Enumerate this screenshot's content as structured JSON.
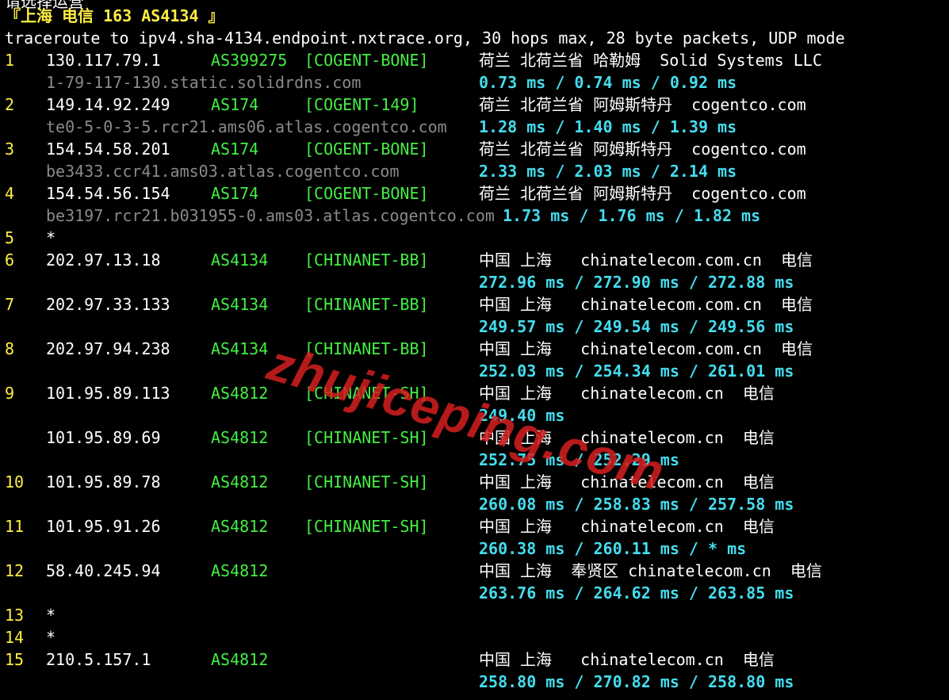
{
  "header": {
    "cut_off_line": "请选择运营",
    "title": "『上海 电信 163 AS4134 』",
    "command": "traceroute to ipv4.sha-4134.endpoint.nxtrace.org, 30 hops max, 28 byte packets, UDP mode"
  },
  "hops": [
    {
      "num": "1",
      "ip": "130.117.79.1",
      "asn": "AS399275",
      "tag": "[COGENT-BONE]",
      "geo": "荷兰 北荷兰省 哈勒姆  Solid Systems LLC",
      "host": "1-79-117-130.static.solidrdns.com",
      "rtt": "0.73 ms / 0.74 ms / 0.92 ms"
    },
    {
      "num": "2",
      "ip": "149.14.92.249",
      "asn": "AS174",
      "tag": "[COGENT-149]",
      "geo": "荷兰 北荷兰省 阿姆斯特丹  cogentco.com",
      "host": "te0-5-0-3-5.rcr21.ams06.atlas.cogentco.com",
      "rtt": "1.28 ms / 1.40 ms / 1.39 ms"
    },
    {
      "num": "3",
      "ip": "154.54.58.201",
      "asn": "AS174",
      "tag": "[COGENT-BONE]",
      "geo": "荷兰 北荷兰省 阿姆斯特丹  cogentco.com",
      "host": "be3433.ccr41.ams03.atlas.cogentco.com",
      "rtt": "2.33 ms / 2.03 ms / 2.14 ms"
    },
    {
      "num": "4",
      "ip": "154.54.56.154",
      "asn": "AS174",
      "tag": "[COGENT-BONE]",
      "geo": "荷兰 北荷兰省 阿姆斯特丹  cogentco.com",
      "host": "be3197.rcr21.b031955-0.ams03.atlas.cogentco.com",
      "rtt": "1.73 ms / 1.76 ms / 1.82 ms"
    },
    {
      "num": "5",
      "star": "*"
    },
    {
      "num": "6",
      "ip": "202.97.13.18",
      "asn": "AS4134",
      "tag": "[CHINANET-BB]",
      "geo": "中国 上海   chinatelecom.com.cn  电信",
      "rtt": "272.96 ms / 272.90 ms / 272.88 ms"
    },
    {
      "num": "7",
      "ip": "202.97.33.133",
      "asn": "AS4134",
      "tag": "[CHINANET-BB]",
      "geo": "中国 上海   chinatelecom.com.cn  电信",
      "rtt": "249.57 ms / 249.54 ms / 249.56 ms"
    },
    {
      "num": "8",
      "ip": "202.97.94.238",
      "asn": "AS4134",
      "tag": "[CHINANET-BB]",
      "geo": "中国 上海   chinatelecom.com.cn  电信",
      "rtt": "252.03 ms / 254.34 ms / 261.01 ms"
    },
    {
      "num": "9",
      "ip": "101.95.89.113",
      "asn": "AS4812",
      "tag": "[CHINANET-SH]",
      "geo": "中国 上海   chinatelecom.cn  电信",
      "rtt": "249.40 ms"
    },
    {
      "num": "",
      "ip": "101.95.89.69",
      "asn": "AS4812",
      "tag": "[CHINANET-SH]",
      "geo": "中国 上海   chinatelecom.cn  电信",
      "rtt": "252.75 ms / 252.29 ms"
    },
    {
      "num": "10",
      "ip": "101.95.89.78",
      "asn": "AS4812",
      "tag": "[CHINANET-SH]",
      "geo": "中国 上海   chinatelecom.cn  电信",
      "rtt": "260.08 ms / 258.83 ms / 257.58 ms"
    },
    {
      "num": "11",
      "ip": "101.95.91.26",
      "asn": "AS4812",
      "tag": "[CHINANET-SH]",
      "geo": "中国 上海   chinatelecom.cn  电信",
      "rtt": "260.38 ms / 260.11 ms / * ms"
    },
    {
      "num": "12",
      "ip": "58.40.245.94",
      "asn": "AS4812",
      "tag": "",
      "geo": "中国 上海  奉贤区 chinatelecom.cn  电信",
      "rtt": "263.76 ms / 264.62 ms / 263.85 ms"
    },
    {
      "num": "13",
      "star": "*"
    },
    {
      "num": "14",
      "star": "*"
    },
    {
      "num": "15",
      "ip": "210.5.157.1",
      "asn": "AS4812",
      "tag": "",
      "geo": "中国 上海   chinatelecom.cn  电信",
      "rtt": "258.80 ms / 270.82 ms / 258.80 ms"
    }
  ],
  "watermark": "zhujiceping.com",
  "colors": {
    "background": "#000000",
    "hop_number": "#ffee44",
    "ip": "#ffffff",
    "asn": "#44ee44",
    "tag": "#44ee44",
    "geo": "#ffffff",
    "hostname": "#8a8a8a",
    "rtt": "#44ddee",
    "watermark": "#d61e1e"
  }
}
